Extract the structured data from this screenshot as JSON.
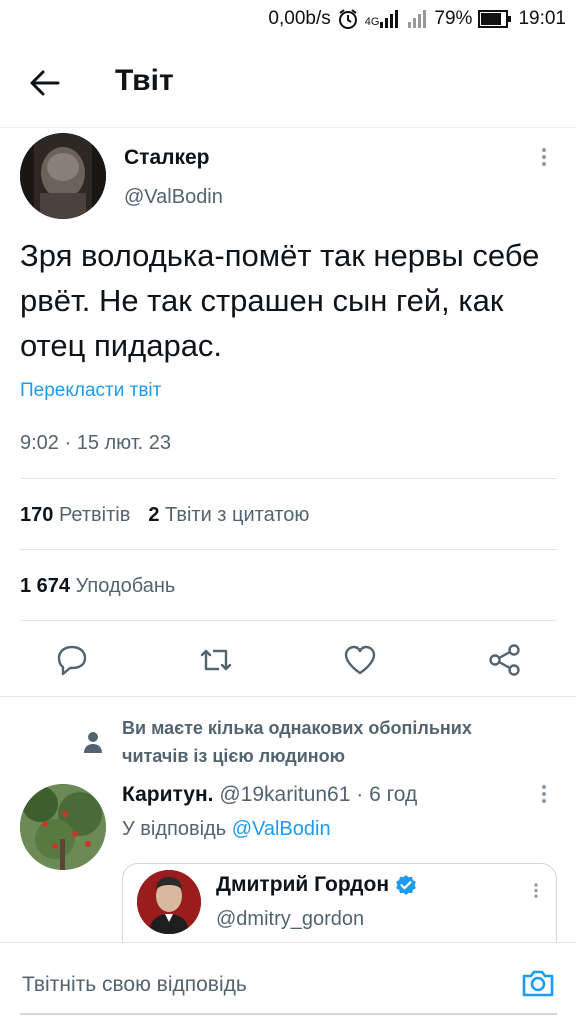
{
  "status_bar": {
    "speed": "0,00b/s",
    "network": "4G",
    "battery": "79%",
    "time": "19:01"
  },
  "header": {
    "title": "Твіт"
  },
  "tweet": {
    "author_name": "Сталкер",
    "author_handle": "@ValBodin",
    "text": "Зря володька-помёт так нервы себе рвёт. Не так страшен сын гей, как отец пидарас.",
    "translate_label": "Перекласти твіт",
    "timestamp": "9:02 · 15 лют. 23",
    "retweets_count": "170",
    "retweets_label": "Ретвітів",
    "quotes_count": "2",
    "quotes_label": "Твіти з цитатою",
    "likes_count": "1 674",
    "likes_label": "Уподобань"
  },
  "actions": {
    "icons": [
      "reply-icon",
      "retweet-icon",
      "like-icon",
      "share-icon"
    ]
  },
  "mutual_notice": {
    "text": "Ви маєте кілька однакових обопільних читачів із цією людиною"
  },
  "reply": {
    "author_name": "Каритун.",
    "author_handle": "@19karitun61",
    "time": "· 6 год",
    "reply_prefix": "У відповідь",
    "reply_to": "@ValBodin",
    "quote": {
      "author_name": "Дмитрий Гордон",
      "author_handle": "@dmitry_gordon",
      "verified": true
    }
  },
  "composer": {
    "placeholder": "Твітніть свою відповідь"
  },
  "colors": {
    "accent": "#1d9bf0",
    "secondary_text": "#536471",
    "primary_text": "#0f1419",
    "divider": "#e1e8ed"
  }
}
